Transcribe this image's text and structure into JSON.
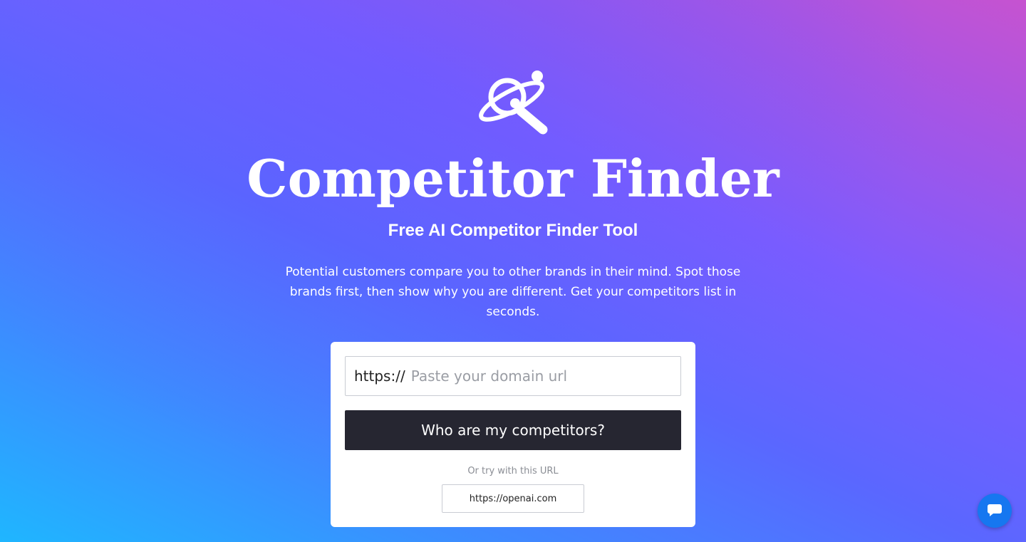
{
  "hero": {
    "title": "Competitor Finder",
    "subtitle": "Free AI Competitor Finder Tool",
    "description": "Potential customers compare you to other brands in their mind. Spot those brands first, then show why you are different. Get your competitors list in seconds.",
    "logo_icon": "magnifier-orbit-icon"
  },
  "form": {
    "url_prefix": "https://",
    "url_placeholder": "Paste your domain url",
    "url_value": "",
    "submit_label": "Who are my competitors?",
    "try_label": "Or try with this URL",
    "sample_url": "https://openai.com"
  },
  "chat": {
    "icon": "chat-bubble-icon"
  },
  "colors": {
    "button_dark": "#262631",
    "chat_blue": "#1677f0",
    "gradient_start": "#1fb6ff",
    "gradient_mid": "#5a67ff",
    "gradient_end": "#c653d0"
  }
}
